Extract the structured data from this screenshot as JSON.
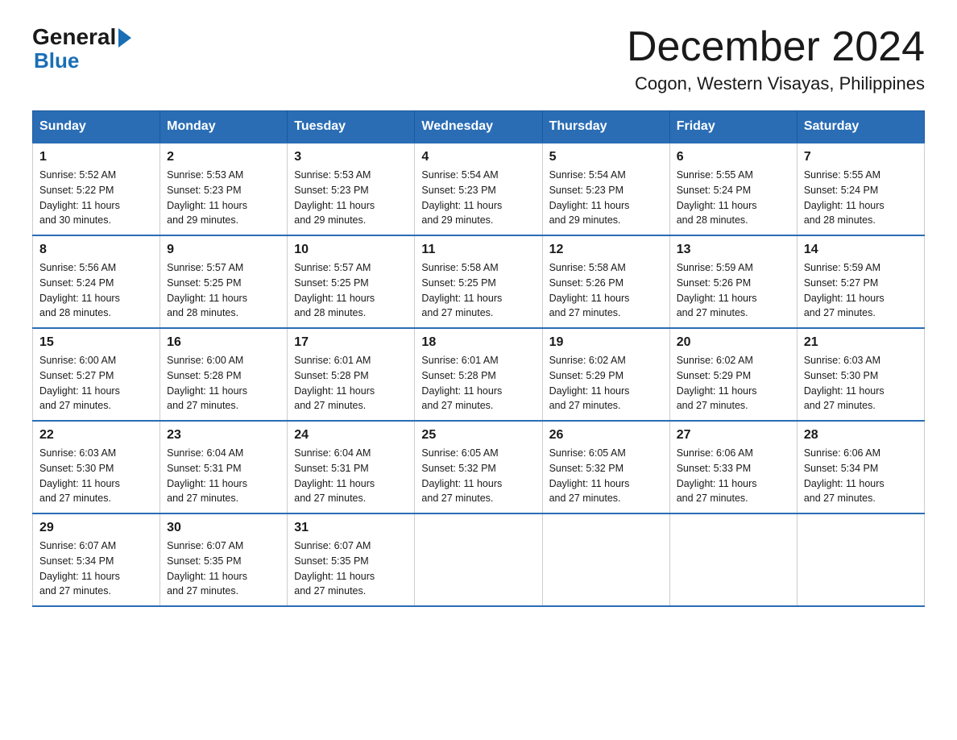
{
  "header": {
    "logo": {
      "text_general": "General",
      "triangle": "▶",
      "text_blue": "Blue"
    },
    "title": "December 2024",
    "location": "Cogon, Western Visayas, Philippines"
  },
  "days_of_week": [
    "Sunday",
    "Monday",
    "Tuesday",
    "Wednesday",
    "Thursday",
    "Friday",
    "Saturday"
  ],
  "weeks": [
    [
      {
        "day": "1",
        "sunrise": "5:52 AM",
        "sunset": "5:22 PM",
        "daylight": "11 hours and 30 minutes."
      },
      {
        "day": "2",
        "sunrise": "5:53 AM",
        "sunset": "5:23 PM",
        "daylight": "11 hours and 29 minutes."
      },
      {
        "day": "3",
        "sunrise": "5:53 AM",
        "sunset": "5:23 PM",
        "daylight": "11 hours and 29 minutes."
      },
      {
        "day": "4",
        "sunrise": "5:54 AM",
        "sunset": "5:23 PM",
        "daylight": "11 hours and 29 minutes."
      },
      {
        "day": "5",
        "sunrise": "5:54 AM",
        "sunset": "5:23 PM",
        "daylight": "11 hours and 29 minutes."
      },
      {
        "day": "6",
        "sunrise": "5:55 AM",
        "sunset": "5:24 PM",
        "daylight": "11 hours and 28 minutes."
      },
      {
        "day": "7",
        "sunrise": "5:55 AM",
        "sunset": "5:24 PM",
        "daylight": "11 hours and 28 minutes."
      }
    ],
    [
      {
        "day": "8",
        "sunrise": "5:56 AM",
        "sunset": "5:24 PM",
        "daylight": "11 hours and 28 minutes."
      },
      {
        "day": "9",
        "sunrise": "5:57 AM",
        "sunset": "5:25 PM",
        "daylight": "11 hours and 28 minutes."
      },
      {
        "day": "10",
        "sunrise": "5:57 AM",
        "sunset": "5:25 PM",
        "daylight": "11 hours and 28 minutes."
      },
      {
        "day": "11",
        "sunrise": "5:58 AM",
        "sunset": "5:25 PM",
        "daylight": "11 hours and 27 minutes."
      },
      {
        "day": "12",
        "sunrise": "5:58 AM",
        "sunset": "5:26 PM",
        "daylight": "11 hours and 27 minutes."
      },
      {
        "day": "13",
        "sunrise": "5:59 AM",
        "sunset": "5:26 PM",
        "daylight": "11 hours and 27 minutes."
      },
      {
        "day": "14",
        "sunrise": "5:59 AM",
        "sunset": "5:27 PM",
        "daylight": "11 hours and 27 minutes."
      }
    ],
    [
      {
        "day": "15",
        "sunrise": "6:00 AM",
        "sunset": "5:27 PM",
        "daylight": "11 hours and 27 minutes."
      },
      {
        "day": "16",
        "sunrise": "6:00 AM",
        "sunset": "5:28 PM",
        "daylight": "11 hours and 27 minutes."
      },
      {
        "day": "17",
        "sunrise": "6:01 AM",
        "sunset": "5:28 PM",
        "daylight": "11 hours and 27 minutes."
      },
      {
        "day": "18",
        "sunrise": "6:01 AM",
        "sunset": "5:28 PM",
        "daylight": "11 hours and 27 minutes."
      },
      {
        "day": "19",
        "sunrise": "6:02 AM",
        "sunset": "5:29 PM",
        "daylight": "11 hours and 27 minutes."
      },
      {
        "day": "20",
        "sunrise": "6:02 AM",
        "sunset": "5:29 PM",
        "daylight": "11 hours and 27 minutes."
      },
      {
        "day": "21",
        "sunrise": "6:03 AM",
        "sunset": "5:30 PM",
        "daylight": "11 hours and 27 minutes."
      }
    ],
    [
      {
        "day": "22",
        "sunrise": "6:03 AM",
        "sunset": "5:30 PM",
        "daylight": "11 hours and 27 minutes."
      },
      {
        "day": "23",
        "sunrise": "6:04 AM",
        "sunset": "5:31 PM",
        "daylight": "11 hours and 27 minutes."
      },
      {
        "day": "24",
        "sunrise": "6:04 AM",
        "sunset": "5:31 PM",
        "daylight": "11 hours and 27 minutes."
      },
      {
        "day": "25",
        "sunrise": "6:05 AM",
        "sunset": "5:32 PM",
        "daylight": "11 hours and 27 minutes."
      },
      {
        "day": "26",
        "sunrise": "6:05 AM",
        "sunset": "5:32 PM",
        "daylight": "11 hours and 27 minutes."
      },
      {
        "day": "27",
        "sunrise": "6:06 AM",
        "sunset": "5:33 PM",
        "daylight": "11 hours and 27 minutes."
      },
      {
        "day": "28",
        "sunrise": "6:06 AM",
        "sunset": "5:34 PM",
        "daylight": "11 hours and 27 minutes."
      }
    ],
    [
      {
        "day": "29",
        "sunrise": "6:07 AM",
        "sunset": "5:34 PM",
        "daylight": "11 hours and 27 minutes."
      },
      {
        "day": "30",
        "sunrise": "6:07 AM",
        "sunset": "5:35 PM",
        "daylight": "11 hours and 27 minutes."
      },
      {
        "day": "31",
        "sunrise": "6:07 AM",
        "sunset": "5:35 PM",
        "daylight": "11 hours and 27 minutes."
      },
      null,
      null,
      null,
      null
    ]
  ],
  "labels": {
    "sunrise": "Sunrise:",
    "sunset": "Sunset:",
    "daylight": "Daylight:"
  },
  "colors": {
    "header_bg": "#2a6db5",
    "header_text": "#ffffff",
    "border": "#aaaaaa",
    "accent": "#2a6db5"
  }
}
